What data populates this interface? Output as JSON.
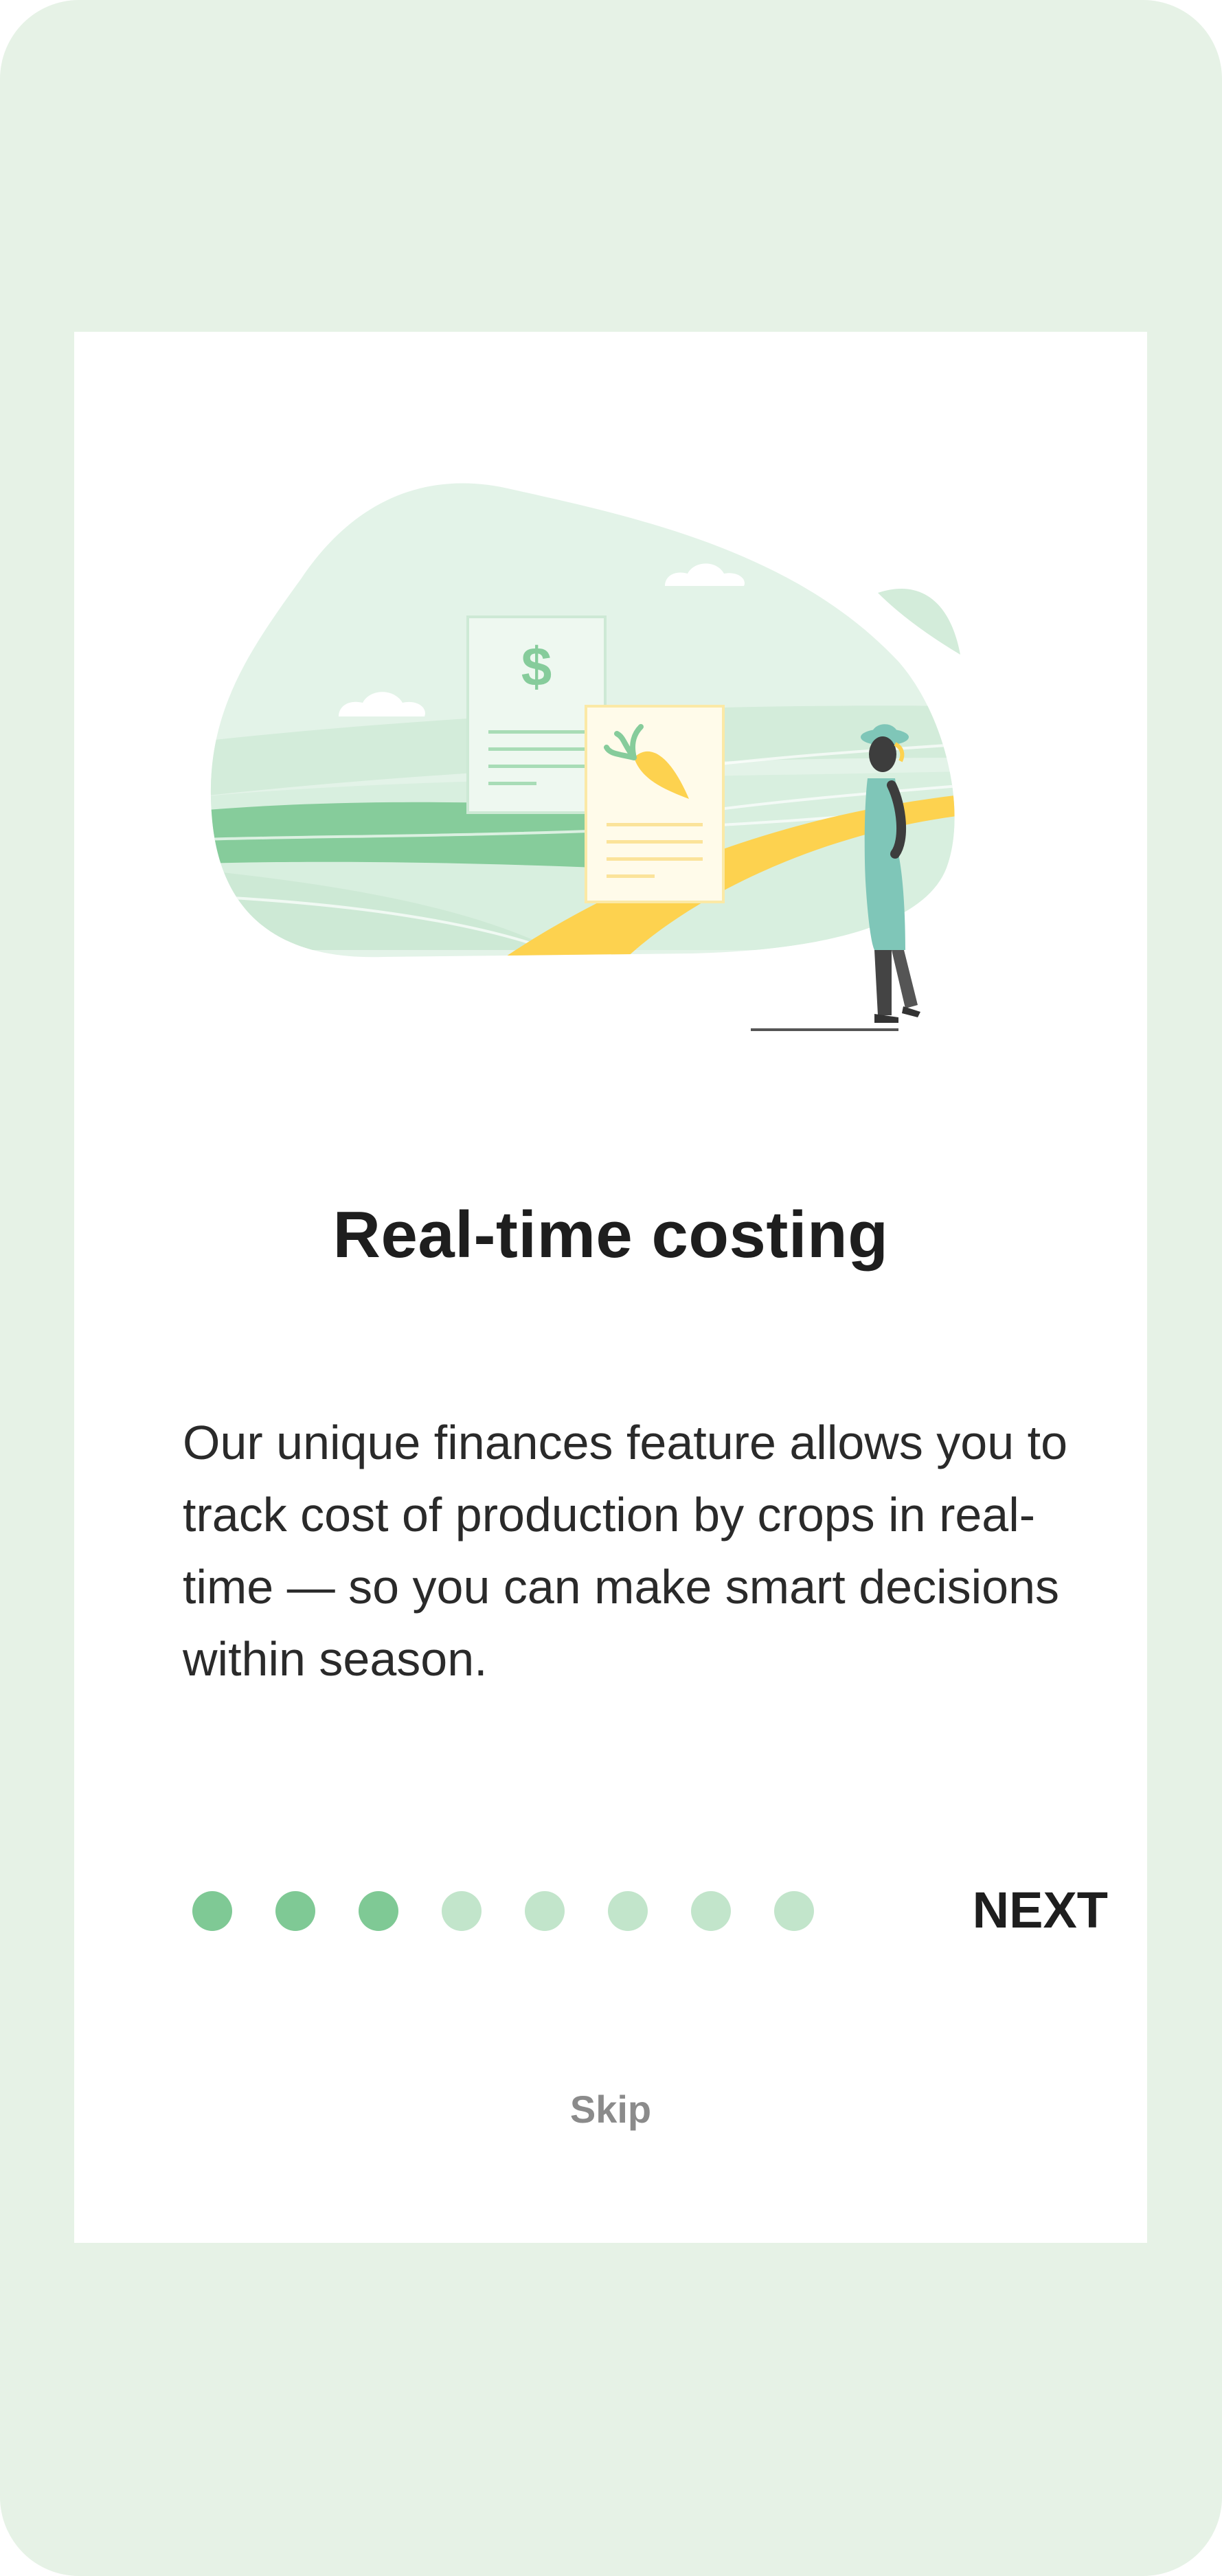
{
  "onboarding": {
    "title": "Real-time costing",
    "description": "Our unique finances feature allows you to track cost of production by crops in real-time —  so you can make smart decisions within season.",
    "next_label": "NEXT",
    "skip_label": "Skip",
    "page_indicator": {
      "total": 8,
      "filled": 3
    },
    "illustration": {
      "receipt_symbol": "$"
    }
  },
  "colors": {
    "background": "#e6f2e6",
    "card": "#ffffff",
    "dot_active": "#7fc995",
    "dot_inactive": "#c2e5cb",
    "title": "#1e1e1e",
    "skip": "#8b8b8b",
    "field_yellow": "#fdd24f",
    "field_green": "#86cc9b",
    "blob": "#e3f3e8"
  }
}
